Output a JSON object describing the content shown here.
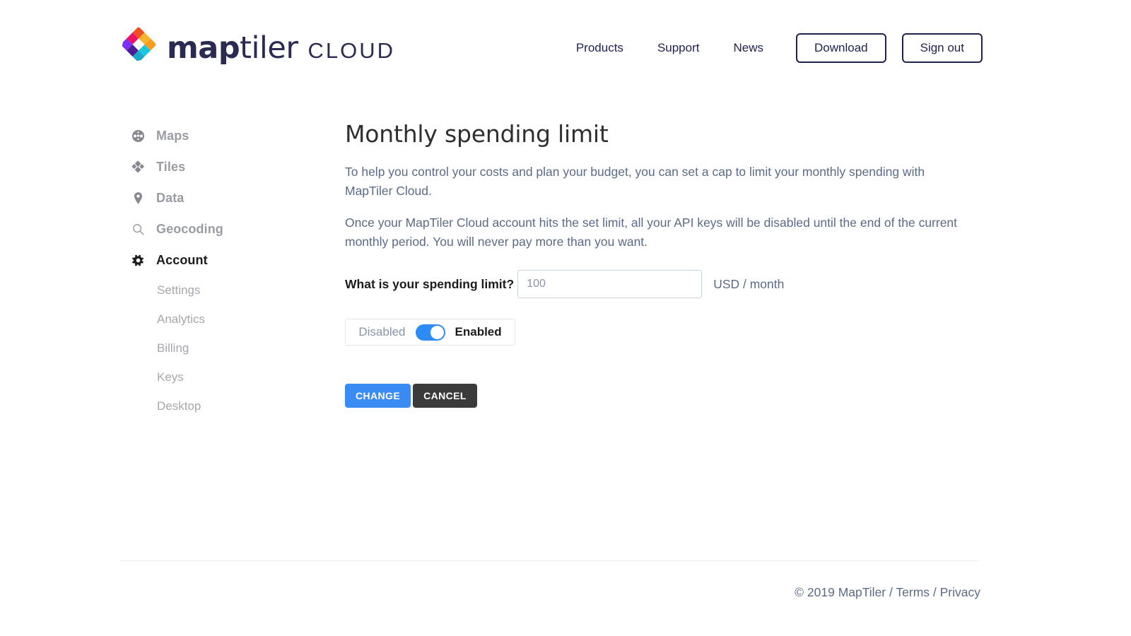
{
  "brand": {
    "name_bold": "map",
    "name_light": "tiler",
    "suffix": "CLOUD",
    "logo_colors": [
      "#f7b32b",
      "#f79c1f",
      "#f04e23",
      "#ed1164",
      "#18c8dc",
      "#1ba8c8",
      "#7b2ff7",
      "#4a1d96"
    ]
  },
  "nav": {
    "links": [
      {
        "label": "Products"
      },
      {
        "label": "Support"
      },
      {
        "label": "News"
      }
    ],
    "buttons": [
      {
        "label": "Download"
      },
      {
        "label": "Sign out"
      }
    ]
  },
  "sidebar": {
    "items": [
      {
        "label": "Maps",
        "icon": "globe-icon",
        "active": false
      },
      {
        "label": "Tiles",
        "icon": "tiles-icon",
        "active": false
      },
      {
        "label": "Data",
        "icon": "map-pin-icon",
        "active": false
      },
      {
        "label": "Geocoding",
        "icon": "search-icon",
        "active": false
      },
      {
        "label": "Account",
        "icon": "gear-icon",
        "active": true
      }
    ],
    "subitems": [
      {
        "label": "Settings"
      },
      {
        "label": "Analytics"
      },
      {
        "label": "Billing"
      },
      {
        "label": "Keys"
      },
      {
        "label": "Desktop"
      }
    ]
  },
  "main": {
    "title": "Monthly spending limit",
    "paragraph1": "To help you control your costs and plan your budget, you can set a cap to limit your monthly spending with MapTiler Cloud.",
    "paragraph2": "Once your MapTiler Cloud account hits the set limit, all your API keys will be disabled until the end of the current monthly period. You will never pay more than you want.",
    "form": {
      "label": "What is your spending limit?",
      "input_value": "",
      "input_placeholder": "100",
      "unit": "USD / month"
    },
    "toggle": {
      "off_label": "Disabled",
      "on_label": "Enabled",
      "state": "Enabled",
      "accent_color": "#2e8bf5"
    },
    "actions": {
      "primary_label": "CHANGE",
      "secondary_label": "CANCEL",
      "primary_color": "#3b8bf4",
      "secondary_color": "#3b3b3b"
    }
  },
  "footer": {
    "text": "© 2019 MapTiler / Terms / Privacy"
  }
}
